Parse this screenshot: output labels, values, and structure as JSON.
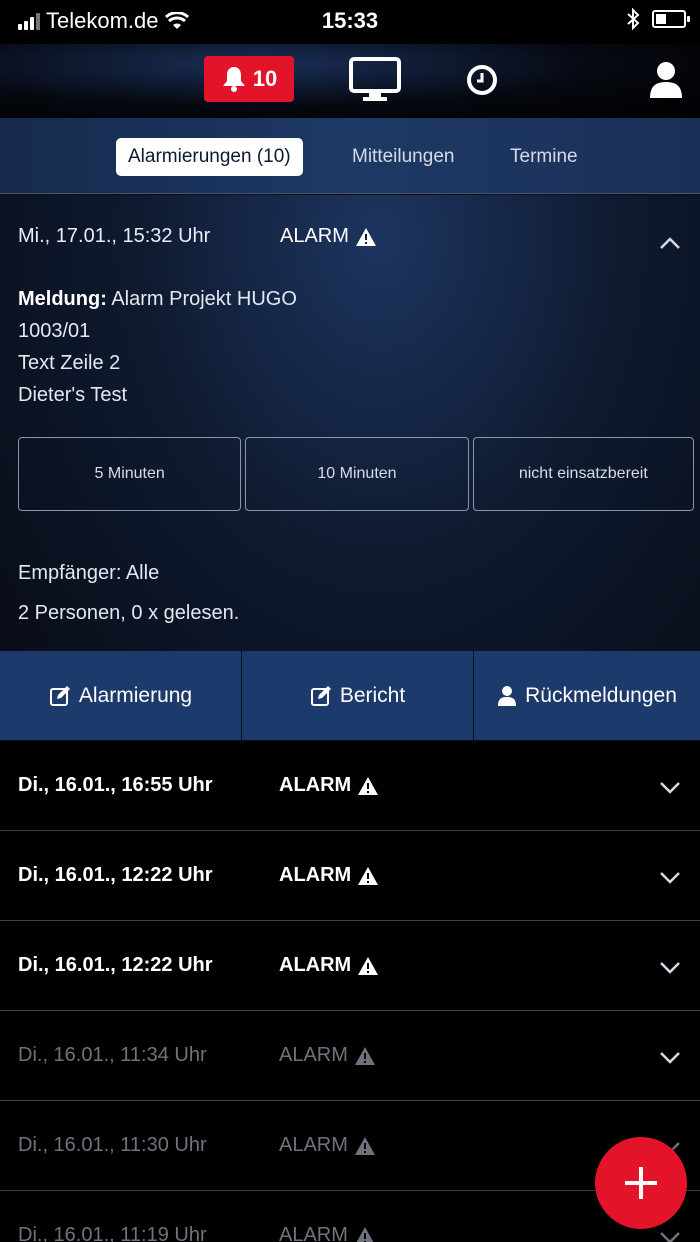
{
  "status_bar": {
    "carrier": "Telekom.de",
    "time": "15:33"
  },
  "top_nav": {
    "alarm_count": "10",
    "accent": "#e3132a"
  },
  "tabs": [
    {
      "label": "Alarmierungen (10)",
      "active": true
    },
    {
      "label": "Mitteilungen",
      "active": false
    },
    {
      "label": "Termine",
      "active": false
    }
  ],
  "expanded_alarm": {
    "datetime": "Mi., 17.01., 15:32 Uhr",
    "type": "ALARM",
    "message_label": "Meldung:",
    "message_title": " Alarm Projekt HUGO",
    "lines": [
      "1003/01",
      "Text Zeile 2",
      "Dieter's Test"
    ],
    "response_buttons": [
      "5 Minuten",
      "10 Minuten",
      "nicht einsatzbereit"
    ],
    "recipients": "Empfänger: Alle",
    "read_stats": "2 Personen, 0 x gelesen.",
    "actions": [
      "Alarmierung",
      "Bericht",
      "Rückmeldungen"
    ]
  },
  "alarm_list": [
    {
      "datetime": "Di., 16.01., 16:55 Uhr",
      "type": "ALARM",
      "unread": true
    },
    {
      "datetime": "Di., 16.01., 12:22 Uhr",
      "type": "ALARM",
      "unread": true
    },
    {
      "datetime": "Di., 16.01., 12:22 Uhr",
      "type": "ALARM",
      "unread": true
    },
    {
      "datetime": "Di., 16.01., 11:34 Uhr",
      "type": "ALARM",
      "unread": false
    },
    {
      "datetime": "Di., 16.01., 11:30 Uhr",
      "type": "ALARM",
      "unread": false
    },
    {
      "datetime": "Di., 16.01., 11:19 Uhr",
      "type": "ALARM",
      "unread": false
    }
  ]
}
